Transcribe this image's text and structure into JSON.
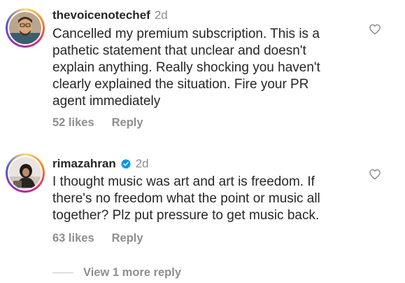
{
  "comments": [
    {
      "username": "thevoicenotechef",
      "time": "2d",
      "verified": false,
      "text": "Cancelled my premium subscription. This is a\npathetic statement that unclear and doesn't\nexplain anything. Really shocking you haven't\nclearly explained the situation. Fire your PR\nagent immediately",
      "likes": "52 likes",
      "reply_label": "Reply"
    },
    {
      "username": "rimazahran",
      "time": "2d",
      "verified": true,
      "text": "I thought music was art and art is freedom. If\nthere's no freedom what the point or music all\ntogether? Plz put pressure to get music back.",
      "likes": "63 likes",
      "reply_label": "Reply"
    }
  ],
  "view_more_label": "View 1 more reply",
  "colors": {
    "text": "#262626",
    "muted": "#8e8e8e",
    "verified": "#0095f6"
  },
  "icons": {
    "like": "heart-icon",
    "verified": "verified-badge-icon"
  }
}
